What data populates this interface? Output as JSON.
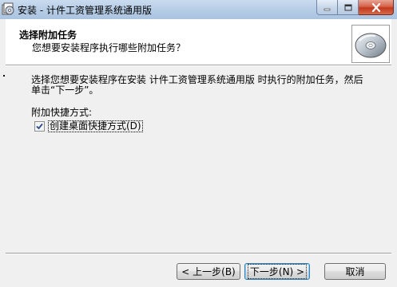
{
  "window": {
    "title": "安装 - 计件工资管理系统通用版"
  },
  "header": {
    "title": "选择附加任务",
    "subtitle": "您想要安装程序执行哪些附加任务？",
    "image_icon": "cd-disc-icon"
  },
  "body": {
    "description": "选择您想要安装程序在安装 计件工资管理系统通用版 时执行的附加任务，然后单击“下一步”。",
    "group_label": "附加快捷方式:",
    "checkbox": {
      "label": "创建桌面快捷方式(D)",
      "checked": true
    }
  },
  "buttons": {
    "back": "< 上一步(B)",
    "next": "下一步(N) >",
    "cancel": "取消"
  },
  "colors": {
    "titlebar": "#b7cde6",
    "close_button": "#c2391e",
    "dialog_bg": "#f0f0f0",
    "header_bg": "#ffffff"
  }
}
